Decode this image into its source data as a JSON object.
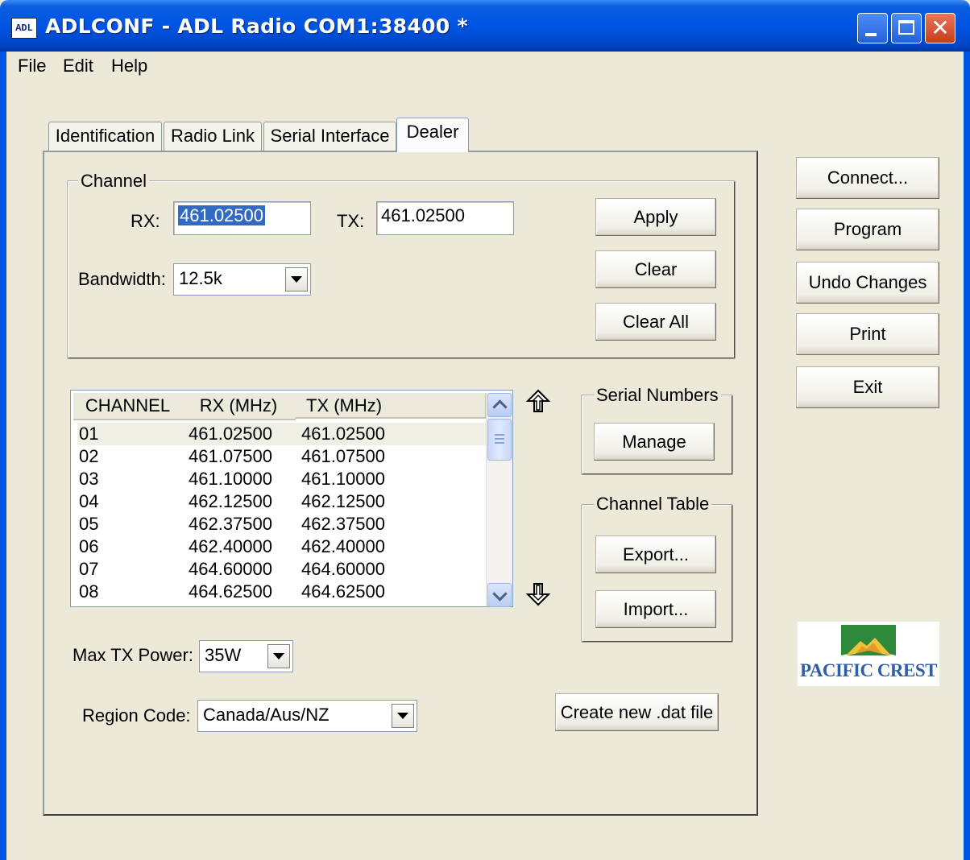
{
  "window": {
    "icon_text": "ADL",
    "title": "ADLCONF - ADL Radio COM1:38400 *"
  },
  "menu": [
    "File",
    "Edit",
    "Help"
  ],
  "tabs": [
    "Identification",
    "Radio Link",
    "Serial Interface",
    "Dealer"
  ],
  "active_tab": "Dealer",
  "channel_group": {
    "label": "Channel",
    "rx_label": "RX:",
    "rx_value": "461.02500",
    "tx_label": "TX:",
    "tx_value": "461.02500",
    "bandwidth_label": "Bandwidth:",
    "bandwidth_value": "12.5k",
    "apply": "Apply",
    "clear": "Clear",
    "clear_all": "Clear All"
  },
  "channel_list": {
    "headers": [
      "CHANNEL",
      "RX (MHz)",
      "TX (MHz)"
    ],
    "rows": [
      [
        "01",
        "461.02500",
        "461.02500"
      ],
      [
        "02",
        "461.07500",
        "461.07500"
      ],
      [
        "03",
        "461.10000",
        "461.10000"
      ],
      [
        "04",
        "462.12500",
        "462.12500"
      ],
      [
        "05",
        "462.37500",
        "462.37500"
      ],
      [
        "06",
        "462.40000",
        "462.40000"
      ],
      [
        "07",
        "464.60000",
        "464.60000"
      ],
      [
        "08",
        "464.62500",
        "464.62500"
      ]
    ]
  },
  "serial_numbers": {
    "label": "Serial Numbers",
    "manage": "Manage"
  },
  "channel_table": {
    "label": "Channel Table",
    "export": "Export...",
    "import": "Import..."
  },
  "max_tx_power": {
    "label": "Max TX Power:",
    "value": "35W"
  },
  "region_code": {
    "label": "Region Code:",
    "value": "Canada/Aus/NZ"
  },
  "create_dat": "Create new .dat file",
  "side_buttons": {
    "connect": "Connect...",
    "program": "Program",
    "undo": "Undo Changes",
    "print": "Print",
    "exit": "Exit"
  },
  "logo_text": "PACIFIC CREST",
  "colors": {
    "title_bar": "#0054e3",
    "face": "#ece9d8",
    "selection": "#316ac5",
    "logo_green": "#2e8a3a",
    "logo_text": "#2e5ea8"
  }
}
